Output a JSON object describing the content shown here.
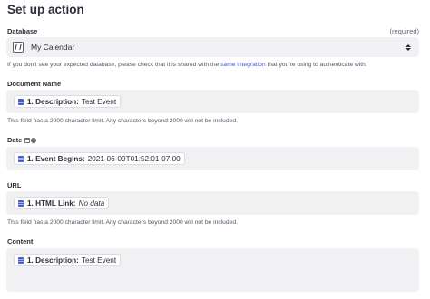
{
  "header": {
    "title": "Set up action"
  },
  "database": {
    "label": "Database",
    "required": "(required)",
    "value": "My Calendar",
    "help_prefix": "If you don't see your expected database, please check that it is shared with the",
    "help_link": "same integration",
    "help_suffix": "that you're using to authenticate with."
  },
  "document_name": {
    "label": "Document Name",
    "pill_step": "1. Description:",
    "pill_value": "Test Event",
    "help": "This field has a 2000 character limit. Any characters beyond 2000 will not be included."
  },
  "date": {
    "label": "Date",
    "pill_step": "1. Event Begins:",
    "pill_value": "2021-06-09T01:52:01-07:00"
  },
  "url": {
    "label": "URL",
    "pill_step": "1. HTML Link:",
    "pill_value": "No data",
    "help": "This field has a 2000 character limit. Any characters beyond 2000 will not be included."
  },
  "content": {
    "label": "Content",
    "pill_step": "1. Description:",
    "pill_value": "Test Event"
  },
  "colors": {
    "field_bg": "#f1f1f3",
    "link": "#3b5bdb",
    "db_icon": "#4a5bd6"
  }
}
